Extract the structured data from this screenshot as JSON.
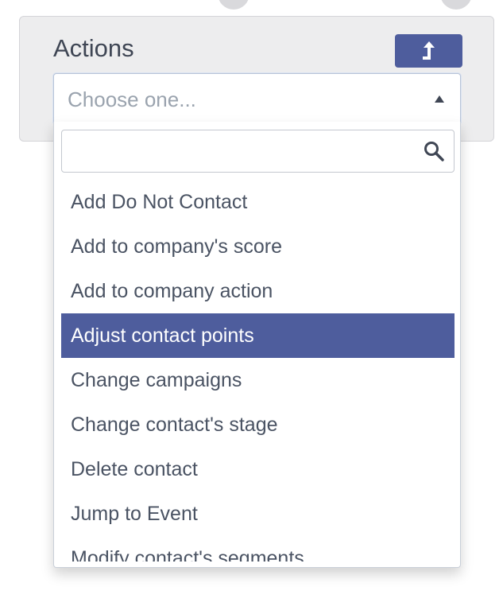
{
  "panel": {
    "title": "Actions",
    "action_button_icon": "arrow-up-icon"
  },
  "select": {
    "placeholder": "Choose one...",
    "caret_icon": "caret-up-icon"
  },
  "dropdown": {
    "search_value": "",
    "search_icon": "search-icon",
    "options": [
      {
        "label": "Add Do Not Contact"
      },
      {
        "label": "Add to company's score"
      },
      {
        "label": "Add to company action"
      },
      {
        "label": "Adjust contact points",
        "selected": true
      },
      {
        "label": "Change campaigns"
      },
      {
        "label": "Change contact's stage"
      },
      {
        "label": "Delete contact"
      },
      {
        "label": "Jump to Event"
      },
      {
        "label": "Modify contact's segments"
      }
    ]
  },
  "colors": {
    "accent": "#4e5d9d",
    "panel_bg": "#ededee",
    "text": "#4a5363",
    "placeholder": "#9aa3ae"
  }
}
